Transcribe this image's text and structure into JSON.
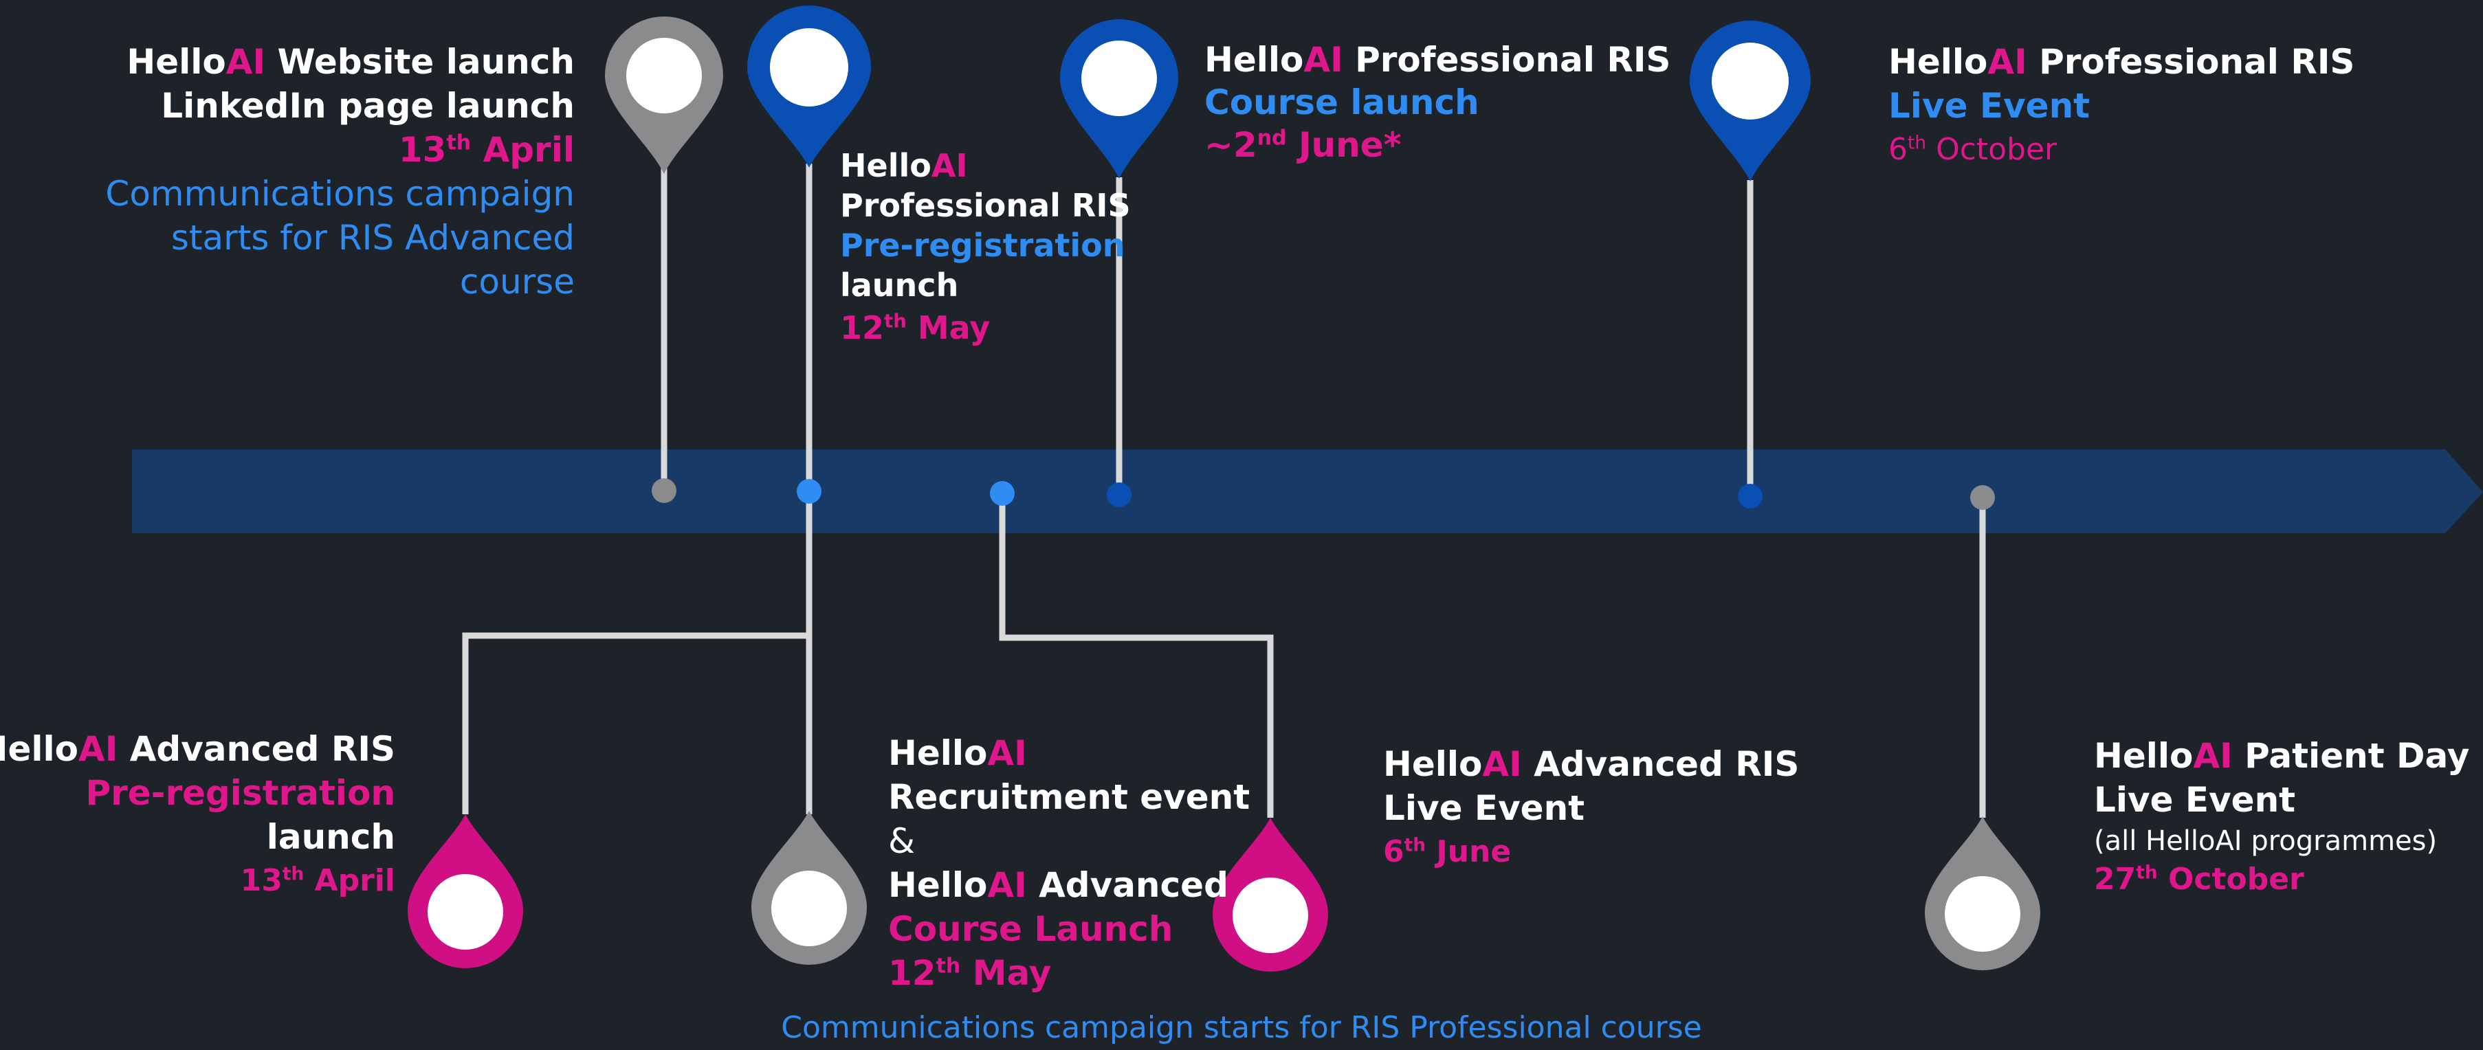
{
  "colors": {
    "background": "#1e2329",
    "arrow": "#173a66",
    "pink": "#e0168c",
    "blue": "#2f8cf2",
    "pin_blue": "#0a4fb3",
    "pin_grey": "#8b8a8d",
    "white": "#ffffff"
  },
  "brand": {
    "hello": "Hello",
    "ai": "AI"
  },
  "events_top": [
    {
      "pin_color": "grey",
      "lines": {
        "title_rest": " Website launch",
        "title_line2": "LinkedIn page  launch",
        "date_day": "13",
        "date_sup": "th",
        "date_rest": " April",
        "campaign_line1": "Communications campaign",
        "campaign_line2": "starts for RIS Advanced",
        "campaign_line3": "course"
      }
    },
    {
      "pin_color": "blue",
      "lines": {
        "title_line2": "Professional RIS",
        "status": "Pre-registration",
        "status_line2": "launch",
        "date_day": "12",
        "date_sup": "th",
        "date_rest": " May"
      }
    },
    {
      "pin_color": "blue",
      "lines": {
        "title_rest": " Professional RIS",
        "status": "Course launch",
        "date_prefix": "~2",
        "date_sup": "nd",
        "date_rest": " June*"
      }
    },
    {
      "pin_color": "blue",
      "lines": {
        "title_rest": " Professional RIS",
        "status": "Live Event",
        "date_day": "6",
        "date_sup": "th",
        "date_rest": " October"
      }
    }
  ],
  "events_bottom": [
    {
      "pin_color": "pink",
      "lines": {
        "title_rest": " Advanced RIS",
        "status": "Pre-registration",
        "status_line2": "launch",
        "date_day": "13",
        "date_sup": "th",
        "date_rest": " April"
      }
    },
    {
      "pin_color": "grey",
      "lines": {
        "title_line2": "Recruitment event",
        "amp": "&",
        "title2_rest": " Advanced",
        "status": "Course Launch",
        "date_day": "12",
        "date_sup": "th",
        "date_rest": " May"
      }
    },
    {
      "pin_color": "pink",
      "lines": {
        "title_rest": " Advanced RIS",
        "status_line": "Live Event",
        "date_day": "6",
        "date_sup": "th",
        "date_rest": " June"
      }
    },
    {
      "pin_color": "grey",
      "lines": {
        "title_rest": " Patient Day",
        "status_line": "Live Event",
        "note": "(all HelloAI programmes)",
        "date_day": "27",
        "date_sup": "th",
        "date_rest": " October"
      }
    }
  ],
  "footer": "Communications campaign starts for RIS Professional course"
}
